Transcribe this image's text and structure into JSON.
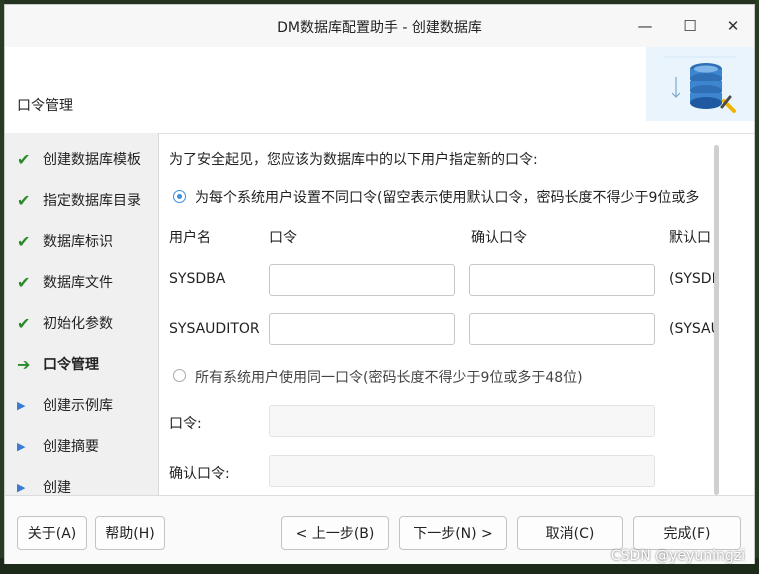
{
  "window": {
    "title": "DM数据库配置助手 - 创建数据库",
    "minimize_glyph": "—",
    "maximize_glyph": "☐",
    "close_glyph": "✕"
  },
  "header": {
    "title": "口令管理"
  },
  "sidebar": {
    "items": [
      {
        "label": "创建数据库模板",
        "state": "done"
      },
      {
        "label": "指定数据库目录",
        "state": "done"
      },
      {
        "label": "数据库标识",
        "state": "done"
      },
      {
        "label": "数据库文件",
        "state": "done"
      },
      {
        "label": "初始化参数",
        "state": "done"
      },
      {
        "label": "口令管理",
        "state": "current"
      },
      {
        "label": "创建示例库",
        "state": "pending"
      },
      {
        "label": "创建摘要",
        "state": "pending"
      },
      {
        "label": "创建",
        "state": "pending"
      }
    ],
    "glyphs": {
      "done": "✔",
      "current": "➔",
      "pending": "▶"
    }
  },
  "main": {
    "intro": "为了安全起见，您应该为数据库中的以下用户指定新的口令:",
    "option_different": "为每个系统用户设置不同口令(留空表示使用默认口令，密码长度不得少于9位或多",
    "columns": {
      "username": "用户名",
      "password": "口令",
      "confirm": "确认口令",
      "default": "默认口"
    },
    "users": [
      {
        "name": "SYSDBA",
        "password": "",
        "confirm": "",
        "default": "(SYSDI"
      },
      {
        "name": "SYSAUDITOR",
        "password": "",
        "confirm": "",
        "default": "(SYSAU"
      }
    ],
    "option_same": "所有系统用户使用同一口令(密码长度不得少于9位或多于48位)",
    "same_password_label": "口令:",
    "same_confirm_label": "确认口令:"
  },
  "footer": {
    "about": "关于(A)",
    "help": "帮助(H)",
    "prev": "< 上一步(B)",
    "next": "下一步(N) >",
    "cancel": "取消(C)",
    "finish": "完成(F)"
  },
  "watermark": "CSDN @yeyuningzi",
  "colors": {
    "accent": "#3a8ee6",
    "check": "#2a8a2a"
  }
}
